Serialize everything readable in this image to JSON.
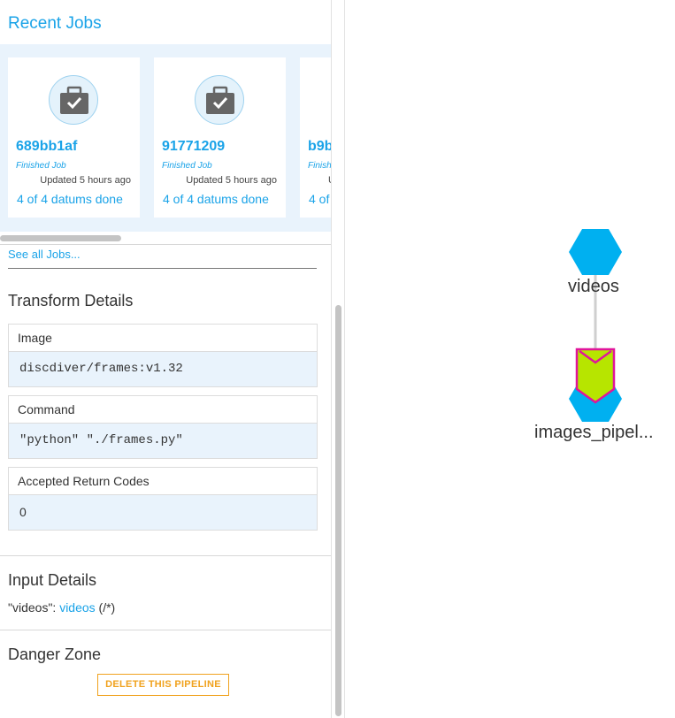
{
  "recent_jobs": {
    "title": "Recent Jobs",
    "jobs": [
      {
        "id": "689bb1af",
        "status": "Finished Job",
        "updated": "Updated 5 hours ago",
        "datums": "4 of 4 datums done"
      },
      {
        "id": "91771209",
        "status": "Finished Job",
        "updated": "Updated 5 hours ago",
        "datums": "4 of 4 datums done"
      },
      {
        "id": "b9b",
        "status": "Finish",
        "updated": "U",
        "datums": "4 of"
      }
    ],
    "see_all": "See all Jobs..."
  },
  "transform": {
    "title": "Transform Details",
    "image_label": "Image",
    "image_value": "discdiver/frames:v1.32",
    "command_label": "Command",
    "command_value": "\"python\" \"./frames.py\"",
    "codes_label": "Accepted Return Codes",
    "codes_value": "0"
  },
  "input": {
    "title": "Input Details",
    "prefix": "\"videos\": ",
    "repo_link": "videos",
    "glob": " (/*)"
  },
  "danger": {
    "title": "Danger Zone",
    "delete_label": "DELETE THIS PIPELINE"
  },
  "dag": {
    "nodes": [
      {
        "label": "videos",
        "icon": "hexagon-repo-icon"
      },
      {
        "label": "images_pipel...",
        "icon": "pipeline-chevron-icon"
      }
    ]
  },
  "colors": {
    "accent": "#1aa3e8",
    "repo_node": "#00b0f0",
    "pipeline_fill": "#b7e500",
    "pipeline_stroke": "#e0159b",
    "danger": "#f0a21e"
  }
}
